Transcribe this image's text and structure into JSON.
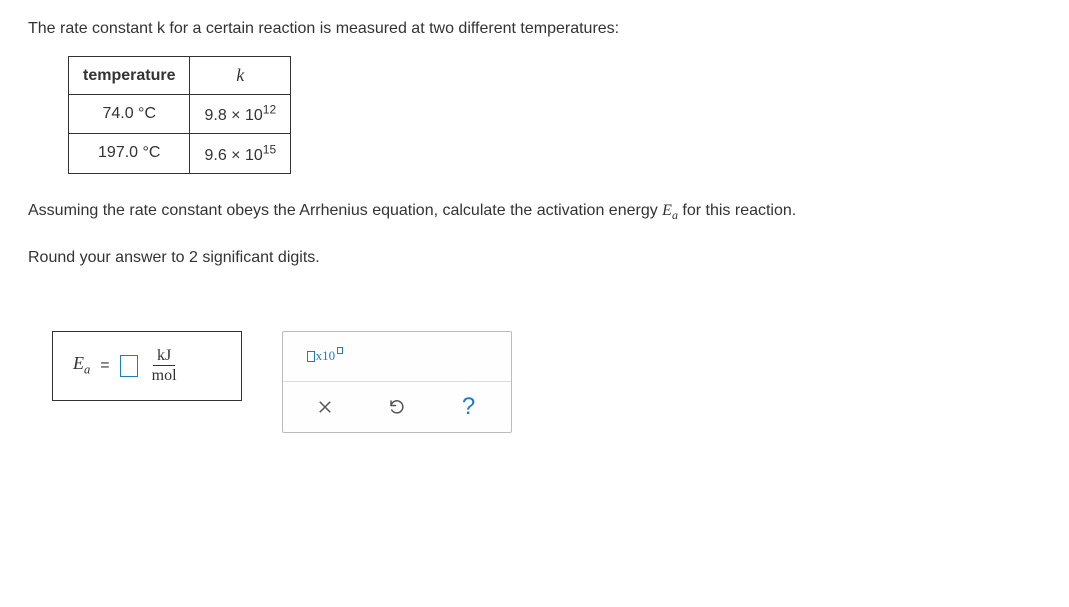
{
  "intro": "The rate constant k for a certain reaction is measured at two different temperatures:",
  "table": {
    "header_temp": "temperature",
    "header_k": "k",
    "rows": [
      {
        "temp": "74.0 °C",
        "k_base": "9.8 × 10",
        "k_exp": "12"
      },
      {
        "temp": "197.0 °C",
        "k_base": "9.6 × 10",
        "k_exp": "15"
      }
    ]
  },
  "assume_pre": "Assuming the rate constant obeys the Arrhenius equation, calculate the activation energy ",
  "assume_var": "E",
  "assume_sub": "a",
  "assume_post": " for this reaction.",
  "round_text": "Round your answer to 2 significant digits.",
  "answer": {
    "label_var": "E",
    "label_sub": "a",
    "equals": " = ",
    "unit_num": "kJ",
    "unit_den": "mol"
  },
  "tools": {
    "sci_x10": "x10",
    "help": "?"
  },
  "chart_data": {
    "type": "table",
    "title": "Rate constant measurements",
    "columns": [
      "temperature (°C)",
      "k"
    ],
    "rows": [
      [
        74.0,
        9800000000000.0
      ],
      [
        197.0,
        9600000000000000.0
      ]
    ]
  }
}
